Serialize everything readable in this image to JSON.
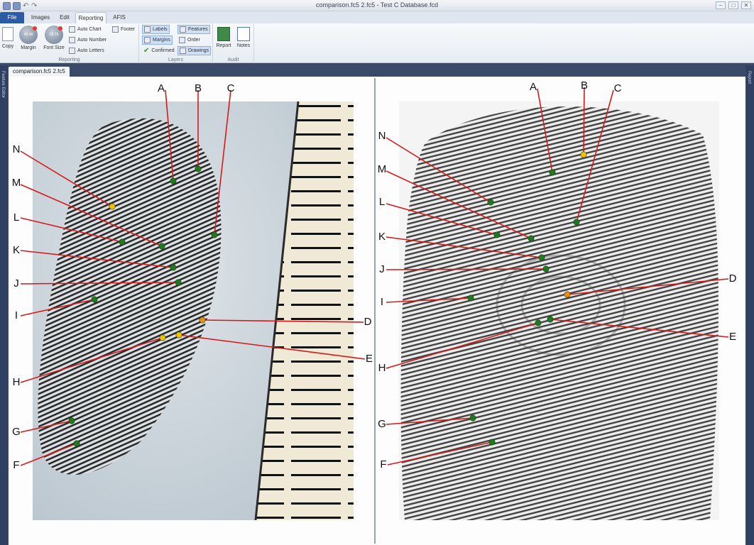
{
  "window": {
    "title": "comparison.fc5 2.fc5 - Test C Database.fcd"
  },
  "tabs": [
    {
      "label": "File"
    },
    {
      "label": "Images"
    },
    {
      "label": "Edit"
    },
    {
      "label": "Reporting"
    },
    {
      "label": "AFIS"
    }
  ],
  "ribbon": {
    "reporting_group": {
      "label": "Reporting",
      "copy": "Copy",
      "margin": "Margin",
      "margin_value": "40.48",
      "font_size": "Font Size",
      "font_value": "28.78",
      "auto_chart": "Auto Chart",
      "auto_number": "Auto Number",
      "auto_letters": "Auto Letters",
      "footer": "Footer"
    },
    "layers_group": {
      "label": "Layers",
      "labels": "Labels",
      "margins": "Margins",
      "confirmed": "Confirmed",
      "features": "Features",
      "order": "Order",
      "drawings": "Drawings"
    },
    "audit_group": {
      "label": "Audit",
      "report": "Report",
      "notes": "Notes"
    }
  },
  "side_panels": {
    "left": "Feature Editor",
    "right": "Report"
  },
  "document_tab": "comparison.fc5 2.fc5",
  "colors": {
    "green_marker": "#1f7a1f",
    "yellow_marker": "#f2c200",
    "orange_marker": "#f08c10",
    "line": "#d61a1a"
  },
  "markers": [
    {
      "letter": "A",
      "left_color": "green",
      "right_color": "green"
    },
    {
      "letter": "B",
      "left_color": "green",
      "right_color": "yellow"
    },
    {
      "letter": "C",
      "left_color": "green",
      "right_color": "green"
    },
    {
      "letter": "D",
      "left_color": "orange",
      "right_color": "orange"
    },
    {
      "letter": "E",
      "left_color": "yellow",
      "right_color": "green"
    },
    {
      "letter": "F",
      "left_color": "green",
      "right_color": "green"
    },
    {
      "letter": "G",
      "left_color": "green",
      "right_color": "green"
    },
    {
      "letter": "H",
      "left_color": "yellow",
      "right_color": "green"
    },
    {
      "letter": "I",
      "left_color": "green",
      "right_color": "green"
    },
    {
      "letter": "J",
      "left_color": "green",
      "right_color": "green"
    },
    {
      "letter": "K",
      "left_color": "green",
      "right_color": "green"
    },
    {
      "letter": "L",
      "left_color": "green",
      "right_color": "green"
    },
    {
      "letter": "M",
      "left_color": "green",
      "right_color": "green"
    },
    {
      "letter": "N",
      "left_color": "yellow",
      "right_color": "green"
    }
  ]
}
